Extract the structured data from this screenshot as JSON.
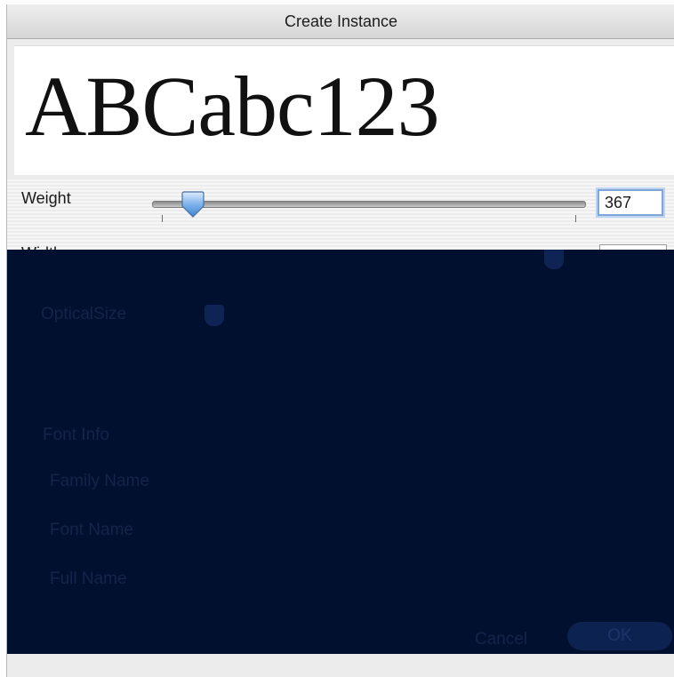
{
  "window": {
    "title": "Create Instance"
  },
  "preview": {
    "sample_text": "ABCabc123"
  },
  "weight": {
    "label": "Weight",
    "value": "367",
    "slider_fraction": 0.1
  },
  "width": {
    "label": "Width"
  },
  "optical_size": {
    "label": "OpticalSize"
  },
  "font_info": {
    "heading": "Font Info",
    "family_name_label": "Family Name",
    "font_name_label": "Font Name",
    "full_name_label": "Full Name"
  },
  "buttons": {
    "cancel_label": "Cancel",
    "ok_label": "OK"
  },
  "colors": {
    "accent": "#7ea6d8",
    "overlay": "#02102f",
    "titlebar": "#d6d6d6"
  }
}
